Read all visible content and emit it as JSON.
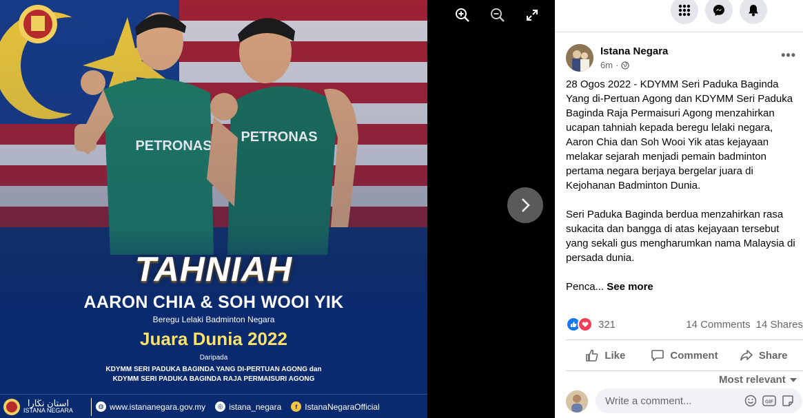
{
  "viewer": {
    "poster": {
      "headline": "TAHNIAH",
      "names": "AARON CHIA & SOH WOOI YIK",
      "subtitle": "Beregu Lelaki Badminton Negara",
      "title": "Juara Dunia 2022",
      "from_label": "Daripada",
      "from_line1": "KDYMM SERI PADUKA BAGINDA YANG DI-PERTUAN AGONG  dan",
      "from_line2": "KDYMM SERI PADUKA BAGINDA RAJA PERMAISURI AGONG",
      "footer": {
        "logo_text_jawi": "استان نڬارا",
        "logo_text": "ISTANA NEGARA",
        "website": "www.istananegara.gov.my",
        "instagram": "istana_negara",
        "facebook": "IstanaNegaraOfficial"
      },
      "colors": {
        "flag_blue": "#0b2a63",
        "flag_red": "#c8202b",
        "jersey_green": "#1f7a63",
        "accent_gold": "#fbe26a"
      }
    },
    "controls": [
      "zoom-in-icon",
      "zoom-out-icon",
      "fullscreen-icon"
    ],
    "next_icon": "chevron-right-icon"
  },
  "panel": {
    "topbar_icons": [
      "menu-grid-icon",
      "messenger-icon",
      "notifications-icon"
    ],
    "author": "Istana Negara",
    "time": "6m",
    "privacy_icon": "globe-icon",
    "body_p1": "28 Ogos 2022 - KDYMM Seri Paduka Baginda Yang di-Pertuan Agong dan KDYMM Seri Paduka Baginda Raja Permaisuri Agong menzahirkan ucapan tahniah kepada beregu lelaki negara, Aaron Chia dan Soh Wooi Yik atas kejayaan melakar sejarah menjadi pemain badminton pertama negara berjaya bergelar juara di Kejohanan Badminton Dunia.",
    "body_p2": "Seri Paduka Baginda berdua menzahirkan rasa sukacita dan bangga di atas kejayaan tersebut yang sekali gus mengharumkan nama Malaysia di persada dunia.",
    "body_truncated": "Penca...",
    "see_more": "See more",
    "reactions_count": "321",
    "comments_count": "14 Comments",
    "shares_count": "14 Shares",
    "actions": {
      "like": "Like",
      "comment": "Comment",
      "share": "Share"
    },
    "sort_label": "Most relevant",
    "comment_placeholder": "Write a comment...",
    "colors": {
      "like_blue": "#1877f2",
      "love_red": "#f33e58",
      "muted_text": "#65676b"
    }
  }
}
